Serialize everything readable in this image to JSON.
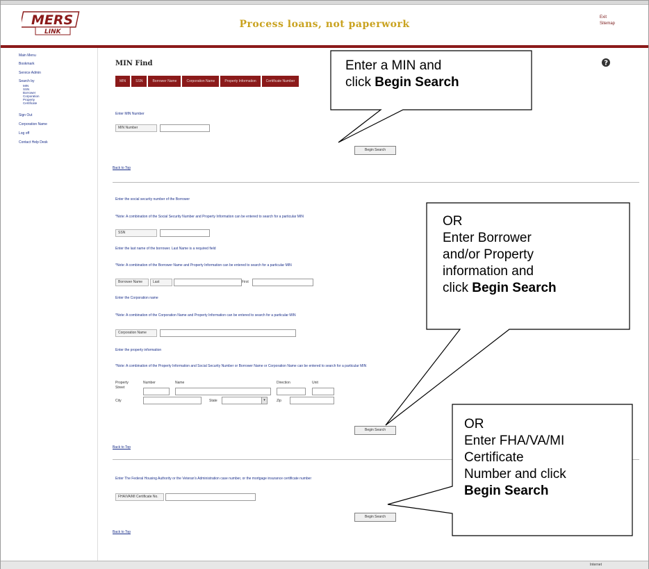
{
  "header": {
    "logo_text": "MERS",
    "logo_sub": "LINK",
    "tagline": "Process loans, not paperwork",
    "right_links": [
      "Exit",
      "Sitemap"
    ]
  },
  "sidebar": {
    "items": [
      {
        "label": "Main Menu"
      },
      {
        "label": "Bookmark"
      },
      {
        "label": "Service Admin"
      },
      {
        "label": "Search by"
      },
      {
        "label": "Sign Out"
      },
      {
        "label": "Corporation Name"
      },
      {
        "label": "Log off"
      },
      {
        "label": "Contact Help Desk"
      }
    ],
    "subitems": [
      "MIN",
      "SSN",
      "Borrower",
      "Corporation",
      "Property",
      "Certificate"
    ]
  },
  "page": {
    "title": "MIN Find",
    "tabs": [
      "MIN",
      "SSN",
      "Borrower Name",
      "Corporation Name",
      "Property Information",
      "Certificate Number"
    ],
    "section_min": {
      "prompt": "Enter MIN Number",
      "field_label": "MIN Number",
      "begin_search": "Begin Search",
      "back_to_top": "Back to Top"
    },
    "section_ssn": {
      "prompt": "Enter the social security number of the Borrower",
      "note": "*Note: A combination of the Social Security Number and Property Information can be entered to search for a particular MIN",
      "field_label": "SSN"
    },
    "section_borrower": {
      "prompt": "Enter the last name of the borrower. Last Name is a required field",
      "note": "*Note: A combination of the Borrower Name and Property Information can be entered to search for a particular MIN",
      "field_label": "Borrower Name",
      "last_label": "Last",
      "first_label": "First"
    },
    "section_corp": {
      "prompt": "Enter the Corporation name",
      "note": "*Note: A combination of the Corporation Name and Property Information can be entered to search for a particular MIN",
      "field_label": "Corporation Name"
    },
    "section_property": {
      "prompt": "Enter the property information",
      "note": "*Note: A combination of the Property Information and Social Security Number or Borrower Name or Corporation Name can be entered to search for a particular MIN",
      "property_label": "Property",
      "street_label": "Street",
      "number_label": "Number",
      "name_label": "Name",
      "direction_label": "Direction",
      "unit_label": "Unit",
      "city_label": "City",
      "state_label": "State",
      "zip_label": "Zip",
      "begin_search": "Begin Search",
      "back_to_top": "Back to Top"
    },
    "section_cert": {
      "prompt": "Enter The Federal Housing Authority or the Veteran's Administration case number, or the mortgage insurance certificate number",
      "field_label": "FHA/VA/MI Certificate No.",
      "begin_search": "Begin Search",
      "back_to_top": "Back to Top"
    }
  },
  "callouts": {
    "one": {
      "line1": "Enter a MIN and",
      "line2_pre": "click ",
      "line2_bold": "Begin Search"
    },
    "two": {
      "line1": "OR",
      "line2": "Enter Borrower",
      "line3": "and/or Property",
      "line4": "information and",
      "line5_pre": "click ",
      "line5_bold": "Begin Search"
    },
    "three": {
      "line1": "OR",
      "line2": "Enter FHA/VA/MI",
      "line3": "Certificate",
      "line4": "Number and click",
      "line5_bold": "Begin Search"
    }
  },
  "statusbar": {
    "zone": "Internet"
  },
  "colors": {
    "brand_red": "#8b1a1a",
    "link_blue": "#1a2f8a",
    "tagline_gold": "#c9a21e"
  }
}
